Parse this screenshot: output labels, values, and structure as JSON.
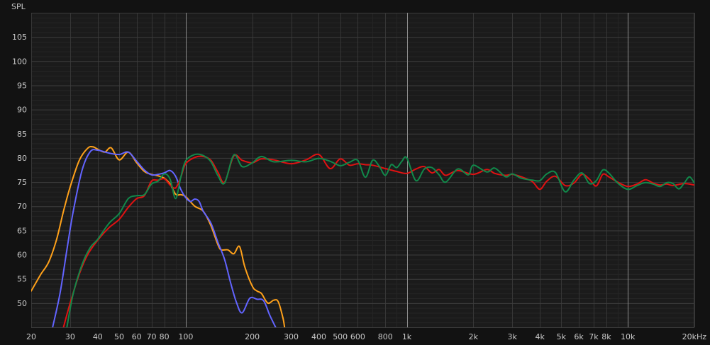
{
  "chart_data": {
    "type": "line",
    "title": "",
    "xlabel": "",
    "ylabel": "SPL",
    "x_scale": "log",
    "xlim": [
      20,
      20000
    ],
    "ylim": [
      45,
      110
    ],
    "grid": true,
    "legend": "none",
    "y_ticks": [
      "50",
      "55",
      "60",
      "65",
      "70",
      "75",
      "80",
      "85",
      "90",
      "95",
      "100",
      "105"
    ],
    "x_ticks": [
      {
        "v": 20,
        "label": "20"
      },
      {
        "v": 30,
        "label": "30"
      },
      {
        "v": 40,
        "label": "40"
      },
      {
        "v": 50,
        "label": "50"
      },
      {
        "v": 60,
        "label": "60"
      },
      {
        "v": 70,
        "label": "70"
      },
      {
        "v": 80,
        "label": "80"
      },
      {
        "v": 100,
        "label": "100"
      },
      {
        "v": 200,
        "label": "200"
      },
      {
        "v": 300,
        "label": "300"
      },
      {
        "v": 400,
        "label": "400"
      },
      {
        "v": 500,
        "label": "500"
      },
      {
        "v": 600,
        "label": "600"
      },
      {
        "v": 800,
        "label": "800"
      },
      {
        "v": 1000,
        "label": "1k"
      },
      {
        "v": 2000,
        "label": "2k"
      },
      {
        "v": 3000,
        "label": "3k"
      },
      {
        "v": 4000,
        "label": "4k"
      },
      {
        "v": 5000,
        "label": "5k"
      },
      {
        "v": 6000,
        "label": "6k"
      },
      {
        "v": 7000,
        "label": "7k"
      },
      {
        "v": 8000,
        "label": "8k"
      },
      {
        "v": 10000,
        "label": "10k"
      },
      {
        "v": 20000,
        "label": "20kHz"
      }
    ],
    "series": [
      {
        "color": "#ffa11a",
        "points": [
          [
            20,
            52.5
          ],
          [
            22,
            55.8
          ],
          [
            24,
            58.5
          ],
          [
            26,
            63
          ],
          [
            28,
            69
          ],
          [
            30,
            74
          ],
          [
            33,
            79.5
          ],
          [
            36,
            82
          ],
          [
            38,
            82.3
          ],
          [
            40,
            81.8
          ],
          [
            43,
            81.2
          ],
          [
            46,
            82.1
          ],
          [
            50,
            79.6
          ],
          [
            55,
            81.2
          ],
          [
            60,
            79
          ],
          [
            65,
            77.2
          ],
          [
            70,
            76.6
          ],
          [
            75,
            76.3
          ],
          [
            80,
            75.8
          ],
          [
            85,
            74.6
          ],
          [
            90,
            72.5
          ],
          [
            95,
            72.4
          ],
          [
            100,
            72
          ],
          [
            110,
            70
          ],
          [
            120,
            69
          ],
          [
            130,
            66
          ],
          [
            140,
            62
          ],
          [
            145,
            61
          ],
          [
            155,
            61
          ],
          [
            165,
            60.2
          ],
          [
            175,
            61.7
          ],
          [
            185,
            57.5
          ],
          [
            200,
            53.5
          ],
          [
            210,
            52.5
          ],
          [
            220,
            52
          ],
          [
            235,
            50
          ],
          [
            250,
            50.6
          ],
          [
            262,
            50.3
          ],
          [
            275,
            47
          ],
          [
            280,
            45
          ]
        ]
      },
      {
        "color": "#6264ff",
        "points": [
          [
            25,
            45
          ],
          [
            27,
            52
          ],
          [
            29,
            61
          ],
          [
            31,
            69
          ],
          [
            34,
            77.5
          ],
          [
            37,
            81.3
          ],
          [
            40,
            81.6
          ],
          [
            45,
            81
          ],
          [
            50,
            80.7
          ],
          [
            55,
            81.2
          ],
          [
            60,
            79.3
          ],
          [
            65,
            77.5
          ],
          [
            70,
            76.5
          ],
          [
            75,
            76.6
          ],
          [
            80,
            76.9
          ],
          [
            85,
            77.4
          ],
          [
            90,
            76.2
          ],
          [
            95,
            73.5
          ],
          [
            100,
            71.8
          ],
          [
            105,
            71
          ],
          [
            110,
            71.5
          ],
          [
            115,
            71
          ],
          [
            120,
            69
          ],
          [
            130,
            66.5
          ],
          [
            140,
            62.5
          ],
          [
            150,
            59
          ],
          [
            160,
            54
          ],
          [
            170,
            50
          ],
          [
            180,
            48
          ],
          [
            195,
            51
          ],
          [
            210,
            50.8
          ],
          [
            225,
            50.5
          ],
          [
            240,
            47.5
          ],
          [
            255,
            45
          ]
        ]
      },
      {
        "color": "#e01212",
        "points": [
          [
            28,
            45
          ],
          [
            30,
            50
          ],
          [
            33,
            56
          ],
          [
            36,
            60
          ],
          [
            40,
            63
          ],
          [
            45,
            65.6
          ],
          [
            50,
            67.3
          ],
          [
            55,
            69.8
          ],
          [
            60,
            71.6
          ],
          [
            65,
            72.2
          ],
          [
            70,
            75.2
          ],
          [
            75,
            75.4
          ],
          [
            80,
            75.7
          ],
          [
            85,
            74.4
          ],
          [
            90,
            73.8
          ],
          [
            95,
            76
          ],
          [
            100,
            78.8
          ],
          [
            110,
            80.1
          ],
          [
            120,
            80.3
          ],
          [
            130,
            79.5
          ],
          [
            140,
            77
          ],
          [
            150,
            75
          ],
          [
            165,
            80.4
          ],
          [
            180,
            79.5
          ],
          [
            200,
            79
          ],
          [
            220,
            79.8
          ],
          [
            250,
            79.6
          ],
          [
            300,
            78.8
          ],
          [
            350,
            79.6
          ],
          [
            400,
            80.7
          ],
          [
            450,
            77.8
          ],
          [
            500,
            79.8
          ],
          [
            550,
            78.5
          ],
          [
            600,
            78.8
          ],
          [
            650,
            78.6
          ],
          [
            700,
            78.5
          ],
          [
            800,
            77.8
          ],
          [
            900,
            77.2
          ],
          [
            1000,
            76.8
          ],
          [
            1100,
            77.7
          ],
          [
            1200,
            78.2
          ],
          [
            1300,
            76.9
          ],
          [
            1400,
            77.6
          ],
          [
            1500,
            76.4
          ],
          [
            1700,
            77.4
          ],
          [
            2000,
            76.6
          ],
          [
            2300,
            77.6
          ],
          [
            2500,
            76.8
          ],
          [
            2800,
            76.4
          ],
          [
            3000,
            76.6
          ],
          [
            3300,
            76.1
          ],
          [
            3700,
            75.1
          ],
          [
            4000,
            73.5
          ],
          [
            4300,
            75.2
          ],
          [
            4700,
            76.2
          ],
          [
            5200,
            74.3
          ],
          [
            5700,
            74.8
          ],
          [
            6200,
            76.6
          ],
          [
            6700,
            75.6
          ],
          [
            7200,
            74.2
          ],
          [
            7700,
            76.6
          ],
          [
            8200,
            76.1
          ],
          [
            9000,
            75
          ],
          [
            10000,
            74.1
          ],
          [
            11000,
            74.6
          ],
          [
            12000,
            75.5
          ],
          [
            13000,
            74.8
          ],
          [
            14000,
            74.4
          ],
          [
            15000,
            74.6
          ],
          [
            16000,
            74.3
          ],
          [
            18000,
            74.7
          ],
          [
            20000,
            74.4
          ]
        ]
      },
      {
        "color": "#11894a",
        "points": [
          [
            29,
            45
          ],
          [
            31,
            52
          ],
          [
            34,
            58
          ],
          [
            37,
            61.5
          ],
          [
            40,
            63.2
          ],
          [
            45,
            66.5
          ],
          [
            50,
            68.5
          ],
          [
            55,
            71.6
          ],
          [
            60,
            72.2
          ],
          [
            65,
            72.4
          ],
          [
            70,
            74.6
          ],
          [
            75,
            75.2
          ],
          [
            80,
            76.7
          ],
          [
            85,
            75.6
          ],
          [
            90,
            71.6
          ],
          [
            95,
            76
          ],
          [
            100,
            79.4
          ],
          [
            110,
            80.7
          ],
          [
            120,
            80.5
          ],
          [
            130,
            79.2
          ],
          [
            140,
            76.3
          ],
          [
            150,
            74.8
          ],
          [
            165,
            80.6
          ],
          [
            180,
            78.2
          ],
          [
            200,
            79
          ],
          [
            220,
            80.3
          ],
          [
            250,
            79.2
          ],
          [
            300,
            79.5
          ],
          [
            350,
            79.2
          ],
          [
            400,
            79.9
          ],
          [
            450,
            79.3
          ],
          [
            500,
            78.4
          ],
          [
            550,
            79.1
          ],
          [
            600,
            79.5
          ],
          [
            650,
            76
          ],
          [
            700,
            79.5
          ],
          [
            750,
            78.3
          ],
          [
            800,
            76.4
          ],
          [
            850,
            78.6
          ],
          [
            900,
            78
          ],
          [
            950,
            79.3
          ],
          [
            1000,
            80
          ],
          [
            1100,
            75.3
          ],
          [
            1200,
            77.7
          ],
          [
            1300,
            78
          ],
          [
            1400,
            76.5
          ],
          [
            1500,
            75
          ],
          [
            1700,
            77.7
          ],
          [
            1900,
            76.5
          ],
          [
            2000,
            78.5
          ],
          [
            2300,
            77.1
          ],
          [
            2500,
            77.9
          ],
          [
            2800,
            76.1
          ],
          [
            3000,
            76.7
          ],
          [
            3300,
            75.8
          ],
          [
            3700,
            75.4
          ],
          [
            4000,
            75.3
          ],
          [
            4300,
            76.7
          ],
          [
            4700,
            77
          ],
          [
            5200,
            73
          ],
          [
            5700,
            75.4
          ],
          [
            6200,
            76.9
          ],
          [
            6700,
            74.7
          ],
          [
            7200,
            75.3
          ],
          [
            7700,
            77.5
          ],
          [
            8200,
            76.9
          ],
          [
            9000,
            74.8
          ],
          [
            10000,
            73.5
          ],
          [
            11000,
            74.3
          ],
          [
            12000,
            74.9
          ],
          [
            13000,
            74.6
          ],
          [
            14000,
            74.1
          ],
          [
            15000,
            74.9
          ],
          [
            16000,
            74.7
          ],
          [
            17000,
            73.6
          ],
          [
            18000,
            74.8
          ],
          [
            19000,
            76.1
          ],
          [
            20000,
            74.8
          ]
        ]
      }
    ]
  }
}
